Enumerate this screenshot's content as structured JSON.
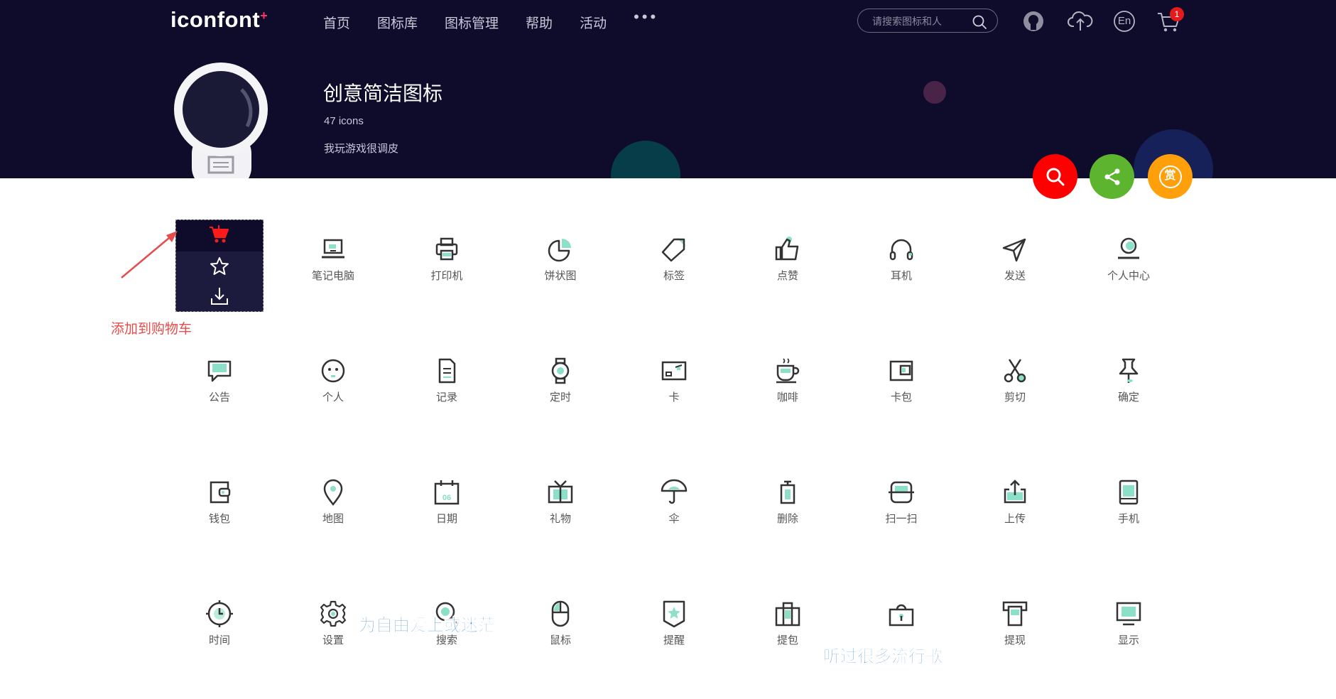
{
  "logo": {
    "text": "iconfont",
    "plus": "+"
  },
  "nav": {
    "items": [
      "首页",
      "图标库",
      "图标管理",
      "帮助",
      "活动"
    ],
    "more": "•••"
  },
  "search": {
    "placeholder": "请搜索图标和人"
  },
  "cart": {
    "badge": "1"
  },
  "lang": "En",
  "collection": {
    "title": "创意简洁图标",
    "count": "47 icons",
    "desc": "我玩游戏很调皮"
  },
  "fab": {
    "reward_label": "赏"
  },
  "icons": [
    {
      "label": "",
      "icon": "hover-actions"
    },
    {
      "label": "笔记电脑",
      "icon": "laptop-icon"
    },
    {
      "label": "打印机",
      "icon": "printer-icon"
    },
    {
      "label": "饼状图",
      "icon": "pie-chart-icon"
    },
    {
      "label": "标签",
      "icon": "tag-icon"
    },
    {
      "label": "点赞",
      "icon": "thumbs-up-icon"
    },
    {
      "label": "耳机",
      "icon": "headphones-icon"
    },
    {
      "label": "发送",
      "icon": "send-icon"
    },
    {
      "label": "个人中心",
      "icon": "user-center-icon"
    },
    {
      "label": "公告",
      "icon": "announcement-icon"
    },
    {
      "label": "个人",
      "icon": "person-icon"
    },
    {
      "label": "记录",
      "icon": "record-icon"
    },
    {
      "label": "定时",
      "icon": "watch-icon"
    },
    {
      "label": "卡",
      "icon": "card-icon"
    },
    {
      "label": "咖啡",
      "icon": "coffee-icon"
    },
    {
      "label": "卡包",
      "icon": "card-wallet-icon"
    },
    {
      "label": "剪切",
      "icon": "scissors-icon"
    },
    {
      "label": "确定",
      "icon": "pin-icon"
    },
    {
      "label": "钱包",
      "icon": "wallet-icon"
    },
    {
      "label": "地图",
      "icon": "map-pin-icon"
    },
    {
      "label": "日期",
      "icon": "calendar-icon"
    },
    {
      "label": "礼物",
      "icon": "gift-icon"
    },
    {
      "label": "伞",
      "icon": "umbrella-icon"
    },
    {
      "label": "删除",
      "icon": "trash-icon"
    },
    {
      "label": "扫一扫",
      "icon": "scan-icon"
    },
    {
      "label": "上传",
      "icon": "upload-icon"
    },
    {
      "label": "手机",
      "icon": "phone-icon"
    },
    {
      "label": "时间",
      "icon": "clock-icon"
    },
    {
      "label": "设置",
      "icon": "gear-icon"
    },
    {
      "label": "搜索",
      "icon": "search-icon"
    },
    {
      "label": "鼠标",
      "icon": "mouse-icon"
    },
    {
      "label": "提醒",
      "icon": "reminder-icon"
    },
    {
      "label": "提包",
      "icon": "handbag-icon"
    },
    {
      "label": "",
      "icon": "lock-bag-icon"
    },
    {
      "label": "提现",
      "icon": "withdraw-icon"
    },
    {
      "label": "显示",
      "icon": "monitor-icon"
    }
  ],
  "cell_date": "06",
  "annotation": "添加到购物车",
  "danmaku": [
    "为自由爱上或迷茫",
    "听过很多流行歌"
  ],
  "colors": {
    "header_bg": "#0f0c2b",
    "accent_mint": "#8ce0c8",
    "fab_search": "#ff0000",
    "fab_share": "#5db42e",
    "fab_reward": "#ff9f0a",
    "cart_badge": "#e41b1b",
    "annotation": "#e54c4c"
  }
}
